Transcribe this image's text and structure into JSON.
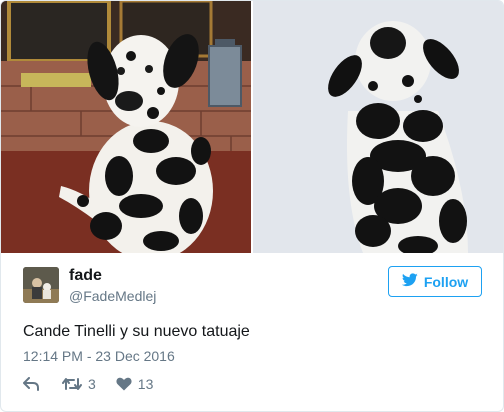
{
  "tweet": {
    "media": [
      {
        "description_icon": "dalmatian-photo-left"
      },
      {
        "description_icon": "dalmatian-photo-right"
      }
    ],
    "author": {
      "name": "fade",
      "handle": "@FadeMedlej",
      "avatar_icon": "user-avatar"
    },
    "follow_button": {
      "label": "Follow",
      "icon": "twitter-bird-icon"
    },
    "text": "Cande Tinelli y su nuevo tatuaje",
    "timestamp": "12:14 PM - 23 Dec 2016",
    "actions": {
      "reply": {
        "icon": "reply-icon"
      },
      "retweet": {
        "icon": "retweet-icon",
        "count": "3"
      },
      "like": {
        "icon": "heart-icon",
        "count": "13"
      }
    }
  },
  "colors": {
    "brand_blue": "#1da1f2",
    "text_primary": "#14171a",
    "text_secondary": "#657786",
    "border": "#e1e8ed"
  }
}
